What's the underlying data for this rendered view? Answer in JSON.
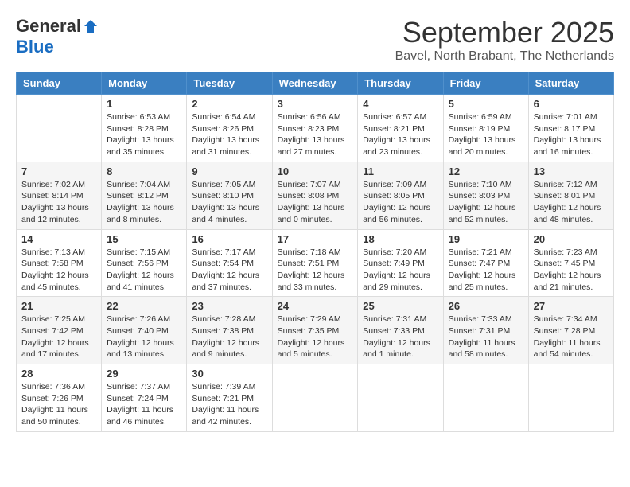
{
  "header": {
    "logo_general": "General",
    "logo_blue": "Blue",
    "month_title": "September 2025",
    "location": "Bavel, North Brabant, The Netherlands"
  },
  "columns": [
    "Sunday",
    "Monday",
    "Tuesday",
    "Wednesday",
    "Thursday",
    "Friday",
    "Saturday"
  ],
  "weeks": [
    [
      {
        "day": "",
        "info": ""
      },
      {
        "day": "1",
        "info": "Sunrise: 6:53 AM\nSunset: 8:28 PM\nDaylight: 13 hours\nand 35 minutes."
      },
      {
        "day": "2",
        "info": "Sunrise: 6:54 AM\nSunset: 8:26 PM\nDaylight: 13 hours\nand 31 minutes."
      },
      {
        "day": "3",
        "info": "Sunrise: 6:56 AM\nSunset: 8:23 PM\nDaylight: 13 hours\nand 27 minutes."
      },
      {
        "day": "4",
        "info": "Sunrise: 6:57 AM\nSunset: 8:21 PM\nDaylight: 13 hours\nand 23 minutes."
      },
      {
        "day": "5",
        "info": "Sunrise: 6:59 AM\nSunset: 8:19 PM\nDaylight: 13 hours\nand 20 minutes."
      },
      {
        "day": "6",
        "info": "Sunrise: 7:01 AM\nSunset: 8:17 PM\nDaylight: 13 hours\nand 16 minutes."
      }
    ],
    [
      {
        "day": "7",
        "info": "Sunrise: 7:02 AM\nSunset: 8:14 PM\nDaylight: 13 hours\nand 12 minutes."
      },
      {
        "day": "8",
        "info": "Sunrise: 7:04 AM\nSunset: 8:12 PM\nDaylight: 13 hours\nand 8 minutes."
      },
      {
        "day": "9",
        "info": "Sunrise: 7:05 AM\nSunset: 8:10 PM\nDaylight: 13 hours\nand 4 minutes."
      },
      {
        "day": "10",
        "info": "Sunrise: 7:07 AM\nSunset: 8:08 PM\nDaylight: 13 hours\nand 0 minutes."
      },
      {
        "day": "11",
        "info": "Sunrise: 7:09 AM\nSunset: 8:05 PM\nDaylight: 12 hours\nand 56 minutes."
      },
      {
        "day": "12",
        "info": "Sunrise: 7:10 AM\nSunset: 8:03 PM\nDaylight: 12 hours\nand 52 minutes."
      },
      {
        "day": "13",
        "info": "Sunrise: 7:12 AM\nSunset: 8:01 PM\nDaylight: 12 hours\nand 48 minutes."
      }
    ],
    [
      {
        "day": "14",
        "info": "Sunrise: 7:13 AM\nSunset: 7:58 PM\nDaylight: 12 hours\nand 45 minutes."
      },
      {
        "day": "15",
        "info": "Sunrise: 7:15 AM\nSunset: 7:56 PM\nDaylight: 12 hours\nand 41 minutes."
      },
      {
        "day": "16",
        "info": "Sunrise: 7:17 AM\nSunset: 7:54 PM\nDaylight: 12 hours\nand 37 minutes."
      },
      {
        "day": "17",
        "info": "Sunrise: 7:18 AM\nSunset: 7:51 PM\nDaylight: 12 hours\nand 33 minutes."
      },
      {
        "day": "18",
        "info": "Sunrise: 7:20 AM\nSunset: 7:49 PM\nDaylight: 12 hours\nand 29 minutes."
      },
      {
        "day": "19",
        "info": "Sunrise: 7:21 AM\nSunset: 7:47 PM\nDaylight: 12 hours\nand 25 minutes."
      },
      {
        "day": "20",
        "info": "Sunrise: 7:23 AM\nSunset: 7:45 PM\nDaylight: 12 hours\nand 21 minutes."
      }
    ],
    [
      {
        "day": "21",
        "info": "Sunrise: 7:25 AM\nSunset: 7:42 PM\nDaylight: 12 hours\nand 17 minutes."
      },
      {
        "day": "22",
        "info": "Sunrise: 7:26 AM\nSunset: 7:40 PM\nDaylight: 12 hours\nand 13 minutes."
      },
      {
        "day": "23",
        "info": "Sunrise: 7:28 AM\nSunset: 7:38 PM\nDaylight: 12 hours\nand 9 minutes."
      },
      {
        "day": "24",
        "info": "Sunrise: 7:29 AM\nSunset: 7:35 PM\nDaylight: 12 hours\nand 5 minutes."
      },
      {
        "day": "25",
        "info": "Sunrise: 7:31 AM\nSunset: 7:33 PM\nDaylight: 12 hours\nand 1 minute."
      },
      {
        "day": "26",
        "info": "Sunrise: 7:33 AM\nSunset: 7:31 PM\nDaylight: 11 hours\nand 58 minutes."
      },
      {
        "day": "27",
        "info": "Sunrise: 7:34 AM\nSunset: 7:28 PM\nDaylight: 11 hours\nand 54 minutes."
      }
    ],
    [
      {
        "day": "28",
        "info": "Sunrise: 7:36 AM\nSunset: 7:26 PM\nDaylight: 11 hours\nand 50 minutes."
      },
      {
        "day": "29",
        "info": "Sunrise: 7:37 AM\nSunset: 7:24 PM\nDaylight: 11 hours\nand 46 minutes."
      },
      {
        "day": "30",
        "info": "Sunrise: 7:39 AM\nSunset: 7:21 PM\nDaylight: 11 hours\nand 42 minutes."
      },
      {
        "day": "",
        "info": ""
      },
      {
        "day": "",
        "info": ""
      },
      {
        "day": "",
        "info": ""
      },
      {
        "day": "",
        "info": ""
      }
    ]
  ]
}
